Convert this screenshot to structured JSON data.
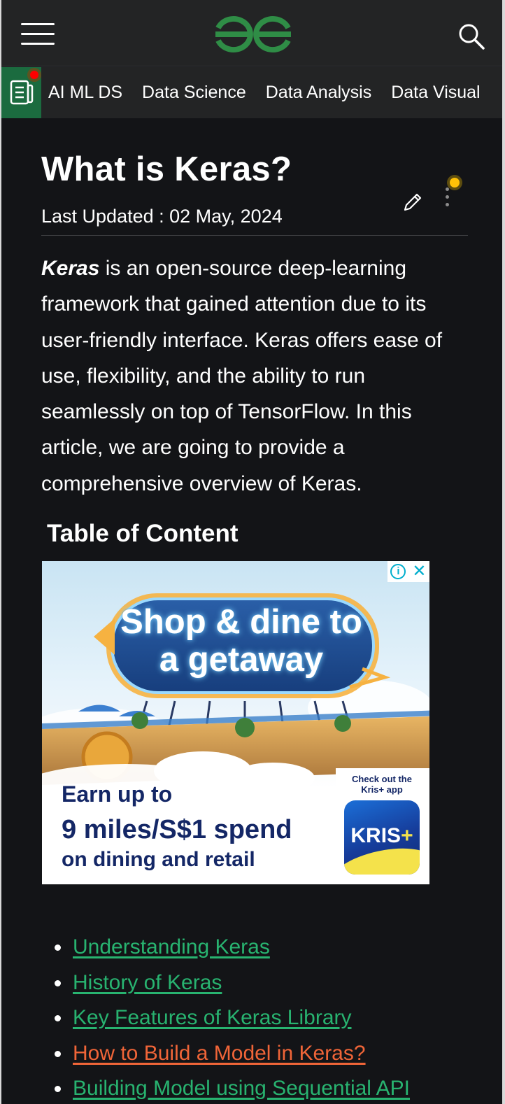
{
  "header": {
    "menu_icon": "hamburger-menu-icon",
    "logo_icon": "geeksforgeeks-logo",
    "search_icon": "search-icon",
    "brand_color": "#2f8d46"
  },
  "category_bar": {
    "icon": "article-list-icon",
    "items": [
      {
        "label": "AI ML DS"
      },
      {
        "label": "Data Science"
      },
      {
        "label": "Data Analysis"
      },
      {
        "label": "Data Visualization"
      }
    ]
  },
  "article": {
    "title": "What is Keras?",
    "last_updated": "Last Updated : 02 May, 2024",
    "edit_icon": "pencil-icon",
    "more_icon": "more-vertical-icon",
    "intro_keyword": "Keras",
    "intro_rest": " is an open-source deep-learning framework that gained attention due to its user-friendly interface. Keras offers ease of use, flexibility, and the ability to run seamlessly on top of TensorFlow. In this article, we are going to provide a comprehensive overview of Keras.",
    "toc_heading": "Table of Content"
  },
  "ad": {
    "headline": "Shop & dine to a getaway",
    "earn": "Earn up to",
    "miles": "9 miles/S$1 spend",
    "dining": "on dining and retail",
    "checkout": "Check out the Kris+ app",
    "app_name": "KRIS",
    "app_plus": "+",
    "info_icon": "ad-info-icon",
    "close_icon": "ad-close-icon",
    "info_glyph": "i",
    "close_glyph": "✕"
  },
  "toc": {
    "items": [
      {
        "label": "Understanding Keras",
        "active": false
      },
      {
        "label": "History of Keras",
        "active": false
      },
      {
        "label": "Key Features of Keras Library",
        "active": false
      },
      {
        "label": "How to Build a Model in Keras?",
        "active": true
      },
      {
        "label": "Building Model using Sequential API",
        "active": false
      }
    ],
    "link_color": "#28b370",
    "active_color": "#f06538"
  }
}
